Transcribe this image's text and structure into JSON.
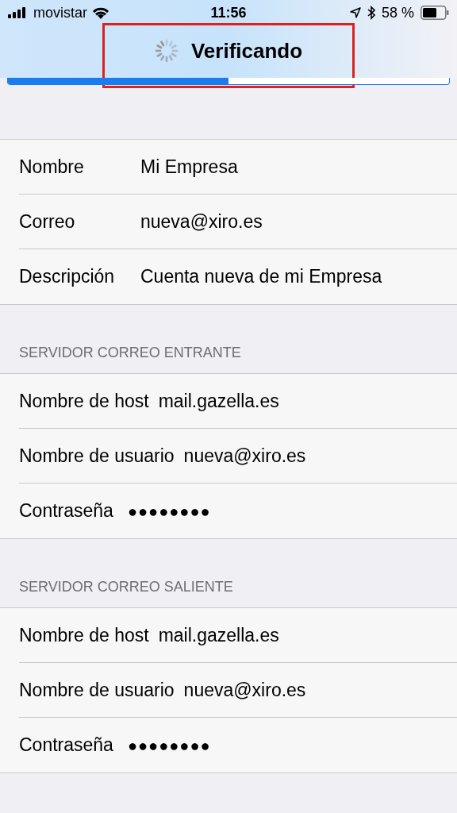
{
  "status_bar": {
    "carrier": "movistar",
    "time": "11:56",
    "battery": "58 %"
  },
  "nav": {
    "title": "Verificando",
    "progress": {
      "level": 0.5
    }
  },
  "groups": [
    {
      "rows": [
        {
          "label": "Nombre",
          "value": "Mi Empresa",
          "kind": "text"
        },
        {
          "label": "Correo",
          "value": "nueva@xiro.es",
          "kind": "text"
        },
        {
          "label": "Descripción",
          "value": "Cuenta nueva de mi Empresa",
          "kind": "text"
        }
      ]
    },
    {
      "header": "SERVIDOR CORREO ENTRANTE",
      "rows": [
        {
          "label": "Nombre de host",
          "value": "mail.gazella.es",
          "kind": "text"
        },
        {
          "label": "Nombre de usuario",
          "value": "nueva@xiro.es",
          "kind": "text"
        },
        {
          "label": "Contraseña",
          "value": "●●●●●●●●",
          "kind": "password"
        }
      ]
    },
    {
      "header": "SERVIDOR CORREO SALIENTE",
      "rows": [
        {
          "label": "Nombre de host",
          "value": "mail.gazella.es",
          "kind": "text"
        },
        {
          "label": "Nombre de usuario",
          "value": "nueva@xiro.es",
          "kind": "text"
        },
        {
          "label": "Contraseña",
          "value": "●●●●●●●●",
          "kind": "password"
        }
      ]
    }
  ]
}
